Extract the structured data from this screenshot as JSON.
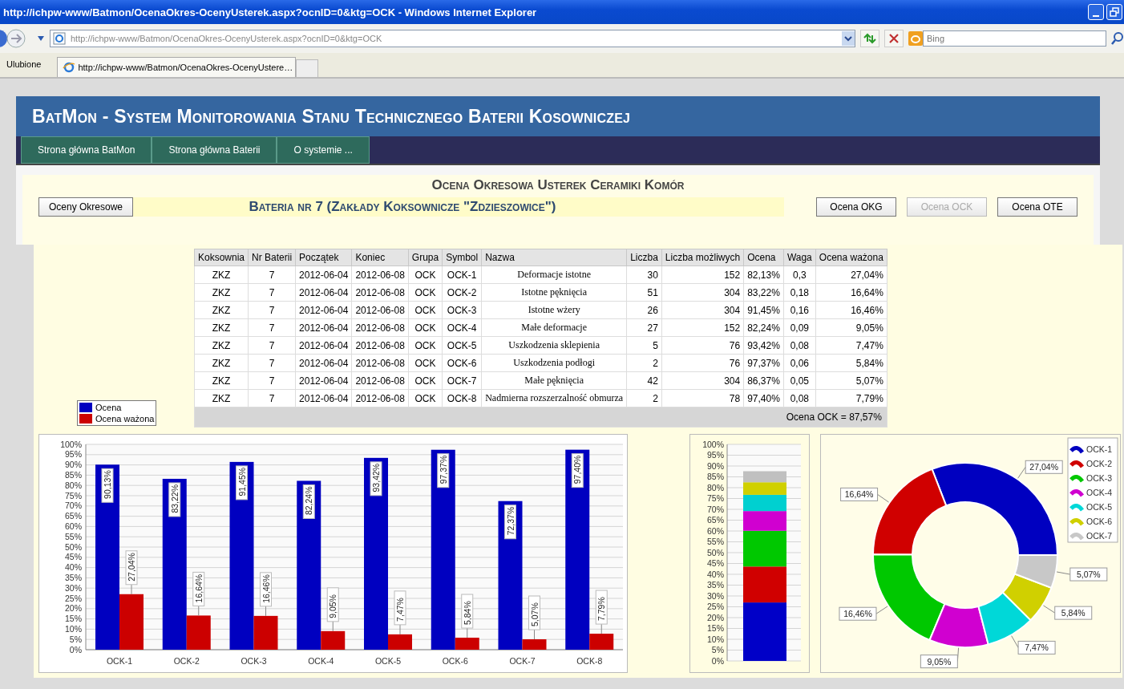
{
  "window": {
    "title": "http://ichpw-www/Batmon/OcenaOkres-OcenyUsterek.aspx?ocnID=0&ktg=OCK - Windows Internet Explorer"
  },
  "address_bar": {
    "value": "http://ichpw-www/Batmon/OcenaOkres-OcenyUsterek.aspx?ocnID=0&ktg=OCK"
  },
  "search": {
    "placeholder": "Bing"
  },
  "favorites": {
    "label": "Ulubione"
  },
  "tabs": [
    {
      "label": "http://ichpw-www/Batmon/OcenaOkres-OcenyUstere…",
      "selected": true
    }
  ],
  "app": {
    "title": "BatMon - System Monitorowania Stanu Technicznego Baterii Kosowniczej"
  },
  "nav": [
    "Strona główna BatMon",
    "Strona główna Baterii",
    "O systemie ..."
  ],
  "page_title": "Ocena Okresowa Usterek Ceramiki Komór",
  "left_button": "Oceny Okresowe",
  "subtitle": "Bateria nr 7 (Zakłady Koksownicze \"Zdzieszowice\")",
  "right_buttons": [
    {
      "label": "Ocena OKG",
      "disabled": false
    },
    {
      "label": "Ocena OCK",
      "disabled": true
    },
    {
      "label": "Ocena OTE",
      "disabled": false
    }
  ],
  "table": {
    "columns": [
      "Koksownia",
      "Nr Baterii",
      "Początek",
      "Koniec",
      "Grupa",
      "Symbol",
      "Nazwa",
      "Liczba",
      "Liczba możliwych",
      "Ocena",
      "Waga",
      "Ocena ważona"
    ],
    "rows": [
      [
        "ZKZ",
        "7",
        "2012-06-04",
        "2012-06-08",
        "OCK",
        "OCK-1",
        "Deformacje istotne",
        "30",
        "152",
        "82,13%",
        "0,3",
        "27,04%"
      ],
      [
        "ZKZ",
        "7",
        "2012-06-04",
        "2012-06-08",
        "OCK",
        "OCK-2",
        "Istotne pęknięcia",
        "51",
        "304",
        "83,22%",
        "0,18",
        "16,64%"
      ],
      [
        "ZKZ",
        "7",
        "2012-06-04",
        "2012-06-08",
        "OCK",
        "OCK-3",
        "Istotne wżery",
        "26",
        "304",
        "91,45%",
        "0,16",
        "16,46%"
      ],
      [
        "ZKZ",
        "7",
        "2012-06-04",
        "2012-06-08",
        "OCK",
        "OCK-4",
        "Małe deformacje",
        "27",
        "152",
        "82,24%",
        "0,09",
        "9,05%"
      ],
      [
        "ZKZ",
        "7",
        "2012-06-04",
        "2012-06-08",
        "OCK",
        "OCK-5",
        "Uszkodzenia sklepienia",
        "5",
        "76",
        "93,42%",
        "0,08",
        "7,47%"
      ],
      [
        "ZKZ",
        "7",
        "2012-06-04",
        "2012-06-08",
        "OCK",
        "OCK-6",
        "Uszkodzenia podłogi",
        "2",
        "76",
        "97,37%",
        "0,06",
        "5,84%"
      ],
      [
        "ZKZ",
        "7",
        "2012-06-04",
        "2012-06-08",
        "OCK",
        "OCK-7",
        "Małe pęknięcia",
        "42",
        "304",
        "86,37%",
        "0,05",
        "5,07%"
      ],
      [
        "ZKZ",
        "7",
        "2012-06-04",
        "2012-06-08",
        "OCK",
        "OCK-8",
        "Nadmierna rozszerzalność obmurza",
        "2",
        "78",
        "97,40%",
        "0,08",
        "7,79%"
      ]
    ],
    "footer": "Ocena OCK = 87,57%"
  },
  "bar_chart": {
    "chart_data": {
      "type": "bar",
      "categories": [
        "OCK-1",
        "OCK-2",
        "OCK-3",
        "OCK-4",
        "OCK-5",
        "OCK-6",
        "OCK-7",
        "OCK-8"
      ],
      "series": [
        {
          "name": "Ocena",
          "color": "#0000c0",
          "values": [
            90.13,
            83.22,
            91.45,
            82.24,
            93.42,
            97.37,
            72.37,
            97.4
          ]
        },
        {
          "name": "Ocena ważona",
          "color": "#cc0000",
          "values": [
            27.04,
            16.64,
            16.46,
            9.05,
            7.47,
            5.84,
            5.07,
            7.79
          ]
        }
      ],
      "value_labels": [
        [
          "90,13%",
          "83,22%",
          "91,45%",
          "82,24%",
          "93,42%",
          "97,37%",
          "72,37%",
          "97,40%"
        ],
        [
          "27,04%",
          "16,64%",
          "16,46%",
          "9,05%",
          "7,47%",
          "5,84%",
          "5,07%",
          "7,79%"
        ]
      ],
      "legend": "left",
      "grid": true,
      "ylim": [
        0,
        100
      ],
      "yticks": [
        {
          "value": 0,
          "label": "0%"
        },
        {
          "value": 5,
          "label": "5%"
        },
        {
          "value": 10,
          "label": "10%"
        },
        {
          "value": 15,
          "label": "15%"
        },
        {
          "value": 20,
          "label": "20%"
        },
        {
          "value": 25,
          "label": "25%"
        },
        {
          "value": 30,
          "label": "30%"
        },
        {
          "value": 35,
          "label": "35%"
        },
        {
          "value": 40,
          "label": "40%"
        },
        {
          "value": 45,
          "label": "45%"
        },
        {
          "value": 50,
          "label": "50%"
        },
        {
          "value": 55,
          "label": "55%"
        },
        {
          "value": 60,
          "label": "60%"
        },
        {
          "value": 65,
          "label": "65%"
        },
        {
          "value": 70,
          "label": "70%"
        },
        {
          "value": 75,
          "label": "75%"
        },
        {
          "value": 80,
          "label": "80%"
        },
        {
          "value": 85,
          "label": "85%"
        },
        {
          "value": 90,
          "label": "90%"
        },
        {
          "value": 95,
          "label": "95%"
        },
        {
          "value": 100,
          "label": "100%"
        }
      ]
    }
  },
  "stack_chart": {
    "chart_data": {
      "type": "bar",
      "stacked": true,
      "grid": true,
      "series": [
        {
          "color": "#0000c8",
          "values": [
            27.0
          ]
        },
        {
          "color": "#d00000",
          "values": [
            16.6
          ]
        },
        {
          "color": "#00c800",
          "values": [
            16.5
          ]
        },
        {
          "color": "#d000d0",
          "values": [
            9.1
          ]
        },
        {
          "color": "#00d0d0",
          "values": [
            7.5
          ]
        },
        {
          "color": "#d0d000",
          "values": [
            5.8
          ]
        },
        {
          "color": "#c0c0c0",
          "values": [
            5.1
          ]
        }
      ],
      "ylim": [
        0,
        100
      ],
      "yticks": [
        {
          "value": 0,
          "label": "0%"
        },
        {
          "value": 5,
          "label": "5%"
        },
        {
          "value": 10,
          "label": "10%"
        },
        {
          "value": 15,
          "label": "15%"
        },
        {
          "value": 20,
          "label": "20%"
        },
        {
          "value": 25,
          "label": "25%"
        },
        {
          "value": 30,
          "label": "30%"
        },
        {
          "value": 35,
          "label": "35%"
        },
        {
          "value": 40,
          "label": "40%"
        },
        {
          "value": 45,
          "label": "45%"
        },
        {
          "value": 50,
          "label": "50%"
        },
        {
          "value": 55,
          "label": "55%"
        },
        {
          "value": 60,
          "label": "60%"
        },
        {
          "value": 65,
          "label": "65%"
        },
        {
          "value": 70,
          "label": "70%"
        },
        {
          "value": 75,
          "label": "75%"
        },
        {
          "value": 80,
          "label": "80%"
        },
        {
          "value": 85,
          "label": "85%"
        },
        {
          "value": 90,
          "label": "90%"
        },
        {
          "value": 95,
          "label": "95%"
        },
        {
          "value": 100,
          "label": "100%"
        }
      ]
    }
  },
  "donut_chart": {
    "chart_data": {
      "type": "donut",
      "legend": "top-right",
      "categories": [
        "OCK-1",
        "OCK-2",
        "OCK-3",
        "OCK-4",
        "OCK-5",
        "OCK-6",
        "OCK-7"
      ],
      "values": [
        27.04,
        16.64,
        16.46,
        9.05,
        7.47,
        5.84,
        5.07
      ],
      "colors": [
        "#0000c0",
        "#d00000",
        "#00c800",
        "#d000d0",
        "#00d8d8",
        "#d0d000",
        "#c8c8c8"
      ],
      "value_labels": [
        "27,04%",
        "16,64%",
        "16,46%",
        "9,05%",
        "7,47%",
        "5,84%",
        "5,07%"
      ]
    }
  }
}
